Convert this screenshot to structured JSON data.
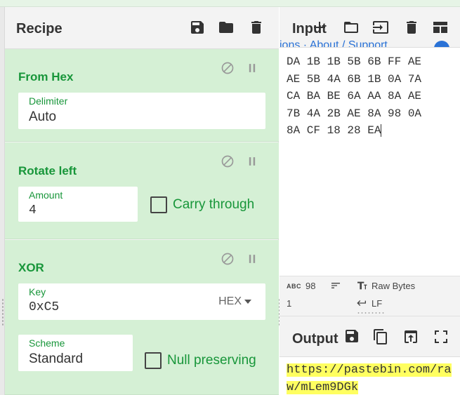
{
  "recipe": {
    "title": "Recipe",
    "header_icons": [
      "save-icon",
      "folder-icon",
      "trash-icon"
    ],
    "operations": [
      {
        "name": "From Hex",
        "fields": [
          {
            "label": "Delimiter",
            "value": "Auto"
          }
        ]
      },
      {
        "name": "Rotate left",
        "fields": [
          {
            "label": "Amount",
            "value": "4"
          }
        ],
        "checkbox": {
          "label": "Carry through",
          "checked": false
        }
      },
      {
        "name": "XOR",
        "fields": [
          {
            "label": "Key",
            "value": "0xC5",
            "encoding": "HEX"
          },
          {
            "label": "Scheme",
            "value": "Standard"
          }
        ],
        "checkbox": {
          "label": "Null preserving",
          "checked": false
        }
      }
    ]
  },
  "input": {
    "title": "Input",
    "header_icons": [
      "add-tab-icon",
      "open-folder-icon",
      "open-file-icon",
      "trash-icon",
      "layout-icon"
    ],
    "ghost_text": "ions · About / Support",
    "lines": [
      "DA 1B 1B 5B 6B FF AE",
      "AE 5B 4A 6B 1B 0A 7A",
      "CA BA BE 6A AA 8A AE",
      "7B 4A 2B AE 8A 98 0A",
      "8A CF 18 28 EA"
    ],
    "status": {
      "length_label": "ABC",
      "length": "98",
      "lines": "1",
      "encoding": "Raw Bytes",
      "eol": "LF"
    }
  },
  "output": {
    "title": "Output",
    "header_icons": [
      "save-icon",
      "copy-icon",
      "replace-input-icon",
      "maximize-icon"
    ],
    "lines": [
      "https://pastebin.com/ra",
      "w/mLem9DGk"
    ]
  },
  "colors": {
    "accent_green": "#18963a",
    "op_background": "#d5f0d5",
    "highlight": "#ffff60",
    "link_blue": "#2a72d6"
  }
}
